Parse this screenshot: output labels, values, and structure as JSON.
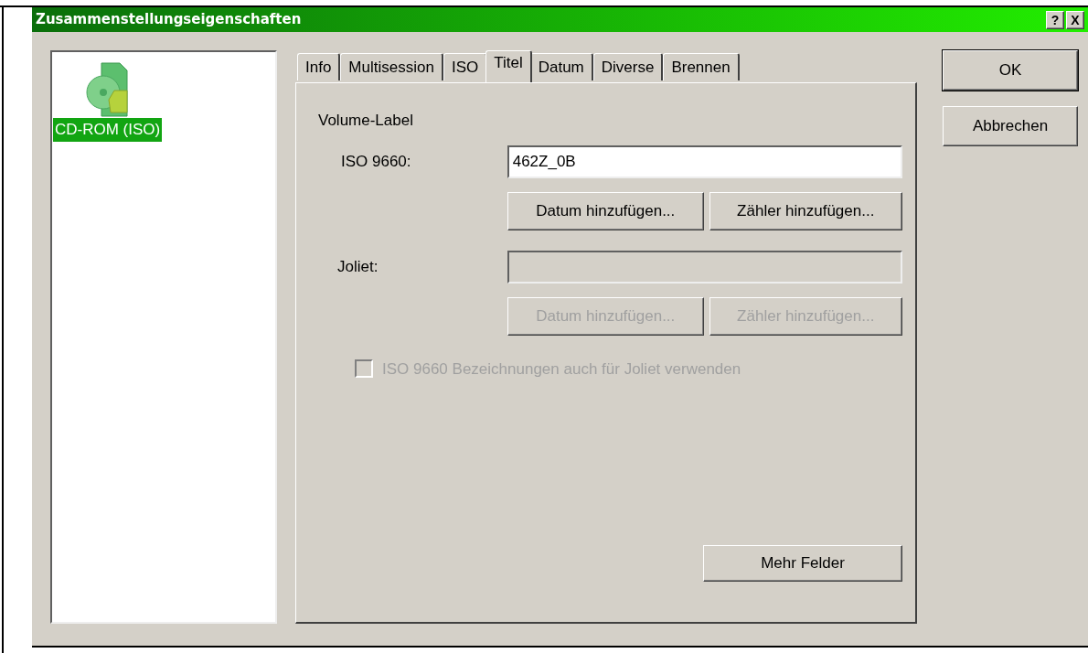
{
  "window": {
    "title": "Zusammenstellungseigenschaften",
    "help_button": "?",
    "close_button": "X"
  },
  "sidebar": {
    "items": [
      {
        "label": "CD-ROM (ISO)",
        "selected": true
      }
    ]
  },
  "tabs": [
    {
      "label": "Info",
      "selected": false
    },
    {
      "label": "Multisession",
      "selected": false
    },
    {
      "label": "ISO",
      "selected": false
    },
    {
      "label": "Titel",
      "selected": true
    },
    {
      "label": "Datum",
      "selected": false
    },
    {
      "label": "Diverse",
      "selected": false
    },
    {
      "label": "Brennen",
      "selected": false
    }
  ],
  "group_label": "Volume-Label",
  "fields": [
    {
      "label": "ISO 9660:",
      "value": "462Z_0B",
      "disabled": false,
      "buttons": [
        "Datum hinzufügen...",
        "Zähler hinzufügen..."
      ]
    },
    {
      "label": "Joliet:",
      "disabled": true,
      "buttons": [
        "Datum hinzufügen...",
        "Zähler hinzufügen..."
      ]
    }
  ],
  "checkbox": {
    "label": "ISO 9660 Bezeichnungen auch für Joliet verwenden",
    "checked": false,
    "disabled": true
  },
  "more_button": "Mehr Felder",
  "buttons": [
    {
      "label": "OK",
      "default": true
    },
    {
      "label": "Abbrechen",
      "default": false
    }
  ]
}
